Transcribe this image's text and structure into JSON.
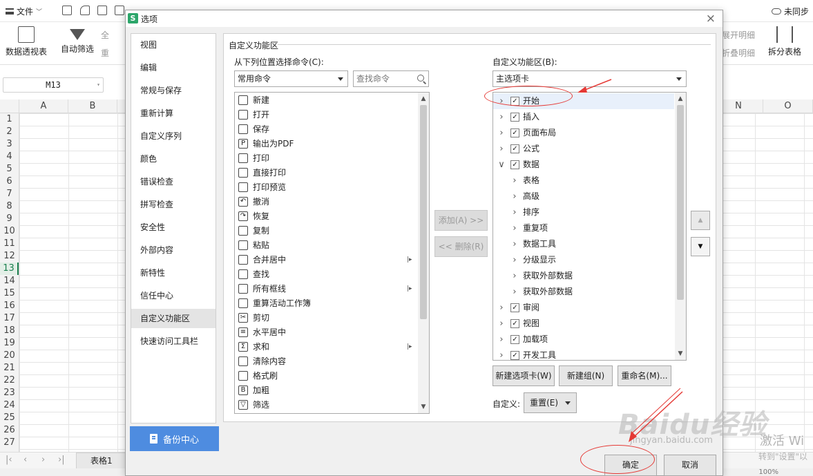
{
  "app": {
    "file_menu": "文件",
    "sync_status": "未同步",
    "ribbon": {
      "pivot_label": "数据透视表",
      "autofilter_label": "自动筛选",
      "partial_left_1": "全",
      "partial_left_2": "重",
      "partial_right_1": "展开明细",
      "partial_right_2": "折叠明细",
      "split_label": "拆分表格"
    },
    "name_box": "M13",
    "columns_left": [
      "A",
      "B"
    ],
    "columns_right": [
      "N",
      "O"
    ],
    "rows": [
      "1",
      "2",
      "3",
      "4",
      "5",
      "6",
      "7",
      "8",
      "9",
      "10",
      "11",
      "12",
      "13",
      "14",
      "15",
      "16",
      "17",
      "18",
      "19",
      "20",
      "21",
      "22",
      "23",
      "24",
      "25",
      "26",
      "27"
    ],
    "active_row": "13",
    "sheet_tab": "表格1",
    "zoom": "100%",
    "watermark": "Baidu经验",
    "watermark_url": "jingyan.baidu.com",
    "activate_title": "激活 Wi",
    "activate_sub": "转到\"设置\"以"
  },
  "dialog": {
    "logo": "S",
    "title": "选项",
    "close": "×",
    "categories": [
      "视图",
      "编辑",
      "常规与保存",
      "重新计算",
      "自定义序列",
      "颜色",
      "错误检查",
      "拼写检查",
      "安全性",
      "外部内容",
      "新特性",
      "信任中心",
      "自定义功能区",
      "快速访问工具栏"
    ],
    "selected_category": "自定义功能区",
    "backup_button": "备份中心",
    "section_title": "自定义功能区",
    "choose_from_label": "从下列位置选择命令(C):",
    "choose_from_value": "常用命令",
    "search_placeholder": "查找命令",
    "commands": [
      {
        "label": "新建",
        "icon": "new-doc-icon",
        "glyph": "",
        "sub": false
      },
      {
        "label": "打开",
        "icon": "open-folder-icon",
        "glyph": "",
        "sub": false
      },
      {
        "label": "保存",
        "icon": "save-icon",
        "glyph": "",
        "sub": false
      },
      {
        "label": "输出为PDF",
        "icon": "pdf-icon",
        "glyph": "P",
        "sub": false
      },
      {
        "label": "打印",
        "icon": "print-icon",
        "glyph": "",
        "sub": false
      },
      {
        "label": "直接打印",
        "icon": "quick-print-icon",
        "glyph": "",
        "sub": false
      },
      {
        "label": "打印预览",
        "icon": "print-preview-icon",
        "glyph": "",
        "sub": false
      },
      {
        "label": "撤消",
        "icon": "undo-icon",
        "glyph": "↶",
        "sub": false
      },
      {
        "label": "恢复",
        "icon": "redo-icon",
        "glyph": "↷",
        "sub": false
      },
      {
        "label": "复制",
        "icon": "copy-icon",
        "glyph": "",
        "sub": false
      },
      {
        "label": "粘贴",
        "icon": "paste-icon",
        "glyph": "",
        "sub": false
      },
      {
        "label": "合并居中",
        "icon": "merge-center-icon",
        "glyph": "",
        "sub": true
      },
      {
        "label": "查找",
        "icon": "find-icon",
        "glyph": "",
        "sub": false
      },
      {
        "label": "所有框线",
        "icon": "all-borders-icon",
        "glyph": "",
        "sub": true
      },
      {
        "label": "重算活动工作簿",
        "icon": "recalc-icon",
        "glyph": "",
        "sub": false
      },
      {
        "label": "剪切",
        "icon": "cut-icon",
        "glyph": "✂",
        "sub": false
      },
      {
        "label": "水平居中",
        "icon": "align-center-icon",
        "glyph": "≡",
        "sub": false
      },
      {
        "label": "求和",
        "icon": "sum-icon",
        "glyph": "Σ",
        "sub": true
      },
      {
        "label": "清除内容",
        "icon": "clear-content-icon",
        "glyph": "",
        "sub": false
      },
      {
        "label": "格式刷",
        "icon": "format-painter-icon",
        "glyph": "",
        "sub": false
      },
      {
        "label": "加粗",
        "icon": "bold-icon",
        "glyph": "B",
        "sub": false
      },
      {
        "label": "筛选",
        "icon": "filter-icon",
        "glyph": "▽",
        "sub": false
      }
    ],
    "add_button": "添加(A) >>",
    "remove_button": "<< 删除(R)",
    "customize_ribbon_label": "自定义功能区(B):",
    "ribbon_scope_value": "主选项卡",
    "tree": [
      {
        "label": "开始",
        "level": 0,
        "checked": true,
        "expanded": false
      },
      {
        "label": "插入",
        "level": 0,
        "checked": true,
        "expanded": false
      },
      {
        "label": "页面布局",
        "level": 0,
        "checked": true,
        "expanded": false
      },
      {
        "label": "公式",
        "level": 0,
        "checked": true,
        "expanded": false
      },
      {
        "label": "数据",
        "level": 0,
        "checked": true,
        "expanded": true
      },
      {
        "label": "表格",
        "level": 1,
        "checked": false,
        "expanded": false
      },
      {
        "label": "高级",
        "level": 1,
        "checked": false,
        "expanded": false
      },
      {
        "label": "排序",
        "level": 1,
        "checked": false,
        "expanded": false
      },
      {
        "label": "重复项",
        "level": 1,
        "checked": false,
        "expanded": false
      },
      {
        "label": "数据工具",
        "level": 1,
        "checked": false,
        "expanded": false
      },
      {
        "label": "分级显示",
        "level": 1,
        "checked": false,
        "expanded": false
      },
      {
        "label": "获取外部数据",
        "level": 1,
        "checked": false,
        "expanded": false
      },
      {
        "label": "获取外部数据",
        "level": 1,
        "checked": false,
        "expanded": false
      },
      {
        "label": "审阅",
        "level": 0,
        "checked": true,
        "expanded": false
      },
      {
        "label": "视图",
        "level": 0,
        "checked": true,
        "expanded": false
      },
      {
        "label": "加载项",
        "level": 0,
        "checked": true,
        "expanded": false
      },
      {
        "label": "开发工具",
        "level": 0,
        "checked": true,
        "expanded": false
      }
    ],
    "move_up": "▲",
    "move_down": "▼",
    "new_tab_button": "新建选项卡(W)",
    "new_group_button": "新建组(N)",
    "rename_button": "重命名(M)...",
    "customize_label": "自定义:",
    "reset_button": "重置(E)",
    "ok_button": "确定",
    "cancel_button": "取消"
  },
  "colors": {
    "accent_blue": "#4e8ce0",
    "annotation_red": "#e53935",
    "wps_green": "#2ca66a"
  }
}
